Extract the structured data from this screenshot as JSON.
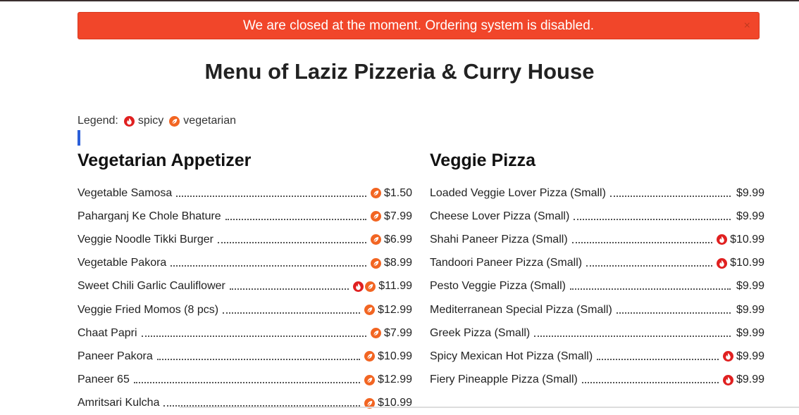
{
  "alert": {
    "message": "We are closed at the moment. Ordering system is disabled.",
    "close": "×"
  },
  "page_title": "Menu of Laziz Pizzeria & Curry House",
  "legend": {
    "label": "Legend:",
    "spicy": "spicy",
    "vegetarian": "vegetarian"
  },
  "colors": {
    "alert_bg": "#f1462a",
    "spicy": "#e02020",
    "vegetarian": "#f26522",
    "accent_bar": "#2b5fd9"
  },
  "sections": [
    {
      "title": "Vegetarian Appetizer",
      "items": [
        {
          "name": "Vegetable Samosa",
          "price": "$1.50",
          "icons": [
            "vegetarian"
          ]
        },
        {
          "name": "Paharganj Ke Chole Bhature",
          "price": "$7.99",
          "icons": [
            "vegetarian"
          ]
        },
        {
          "name": "Veggie Noodle Tikki Burger",
          "price": "$6.99",
          "icons": [
            "vegetarian"
          ]
        },
        {
          "name": "Vegetable Pakora",
          "price": "$8.99",
          "icons": [
            "vegetarian"
          ]
        },
        {
          "name": "Sweet Chili Garlic Cauliflower",
          "price": "$11.99",
          "icons": [
            "spicy",
            "vegetarian"
          ]
        },
        {
          "name": "Veggie Fried Momos (8 pcs)",
          "price": "$12.99",
          "icons": [
            "vegetarian"
          ]
        },
        {
          "name": "Chaat Papri",
          "price": "$7.99",
          "icons": [
            "vegetarian"
          ]
        },
        {
          "name": "Paneer Pakora",
          "price": "$10.99",
          "icons": [
            "vegetarian"
          ]
        },
        {
          "name": "Paneer 65",
          "price": "$12.99",
          "icons": [
            "vegetarian"
          ]
        },
        {
          "name": "Amritsari Kulcha",
          "price": "$10.99",
          "icons": [
            "vegetarian"
          ]
        }
      ]
    },
    {
      "title": "Veggie Pizza",
      "items": [
        {
          "name": "Loaded Veggie Lover Pizza (Small)",
          "price": "$9.99",
          "icons": []
        },
        {
          "name": "Cheese Lover Pizza (Small)",
          "price": "$9.99",
          "icons": []
        },
        {
          "name": "Shahi Paneer Pizza (Small)",
          "price": "$10.99",
          "icons": [
            "spicy"
          ]
        },
        {
          "name": "Tandoori Paneer Pizza (Small)",
          "price": "$10.99",
          "icons": [
            "spicy"
          ]
        },
        {
          "name": "Pesto Veggie Pizza (Small)",
          "price": "$9.99",
          "icons": []
        },
        {
          "name": "Mediterranean Special Pizza (Small)",
          "price": "$9.99",
          "icons": []
        },
        {
          "name": "Greek Pizza (Small)",
          "price": "$9.99",
          "icons": []
        },
        {
          "name": "Spicy Mexican Hot Pizza (Small)",
          "price": "$9.99",
          "icons": [
            "spicy"
          ]
        },
        {
          "name": "Fiery Pineapple Pizza (Small)",
          "price": "$9.99",
          "icons": [
            "spicy"
          ]
        }
      ]
    }
  ]
}
